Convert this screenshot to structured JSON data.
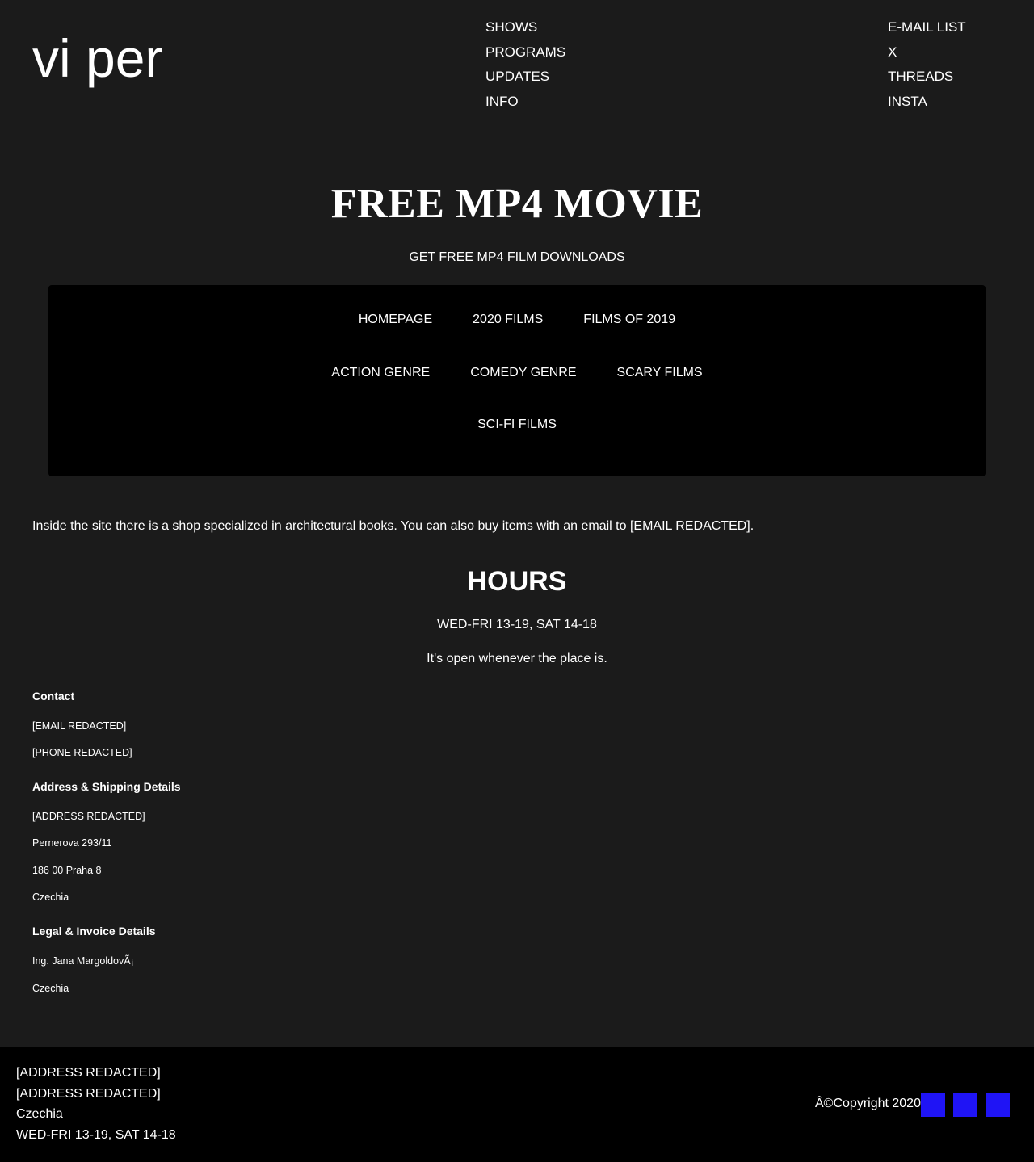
{
  "header": {
    "logo": "vi per",
    "nav_main": [
      "SHOWS",
      "PROGRAMS",
      "UPDATES",
      "INFO"
    ],
    "nav_social": [
      "E-MAIL LIST",
      "X",
      "THREADS",
      "INSTA"
    ]
  },
  "hero": {
    "title": "FREE MP4 MOVIE",
    "subtitle": "GET FREE MP4 FILM DOWNLOADS"
  },
  "menu": {
    "row1": [
      "HOMEPAGE",
      "2020 FILMS",
      "FILMS OF 2019"
    ],
    "row2": [
      "ACTION GENRE",
      "COMEDY GENRE",
      "SCARY FILMS"
    ],
    "row3": [
      "SCI-FI FILMS"
    ]
  },
  "intro": "Inside the site there is a shop specialized in architectural books. You can also buy items with an email to [EMAIL REDACTED].",
  "hours": {
    "title": "HOURS",
    "time": "WED-FRI 13-19, SAT 14-18",
    "note": "It's open whenever the place is."
  },
  "contact": {
    "heading": "Contact",
    "email": "[EMAIL REDACTED]",
    "phone": "[PHONE REDACTED]"
  },
  "address": {
    "heading": "Address & Shipping Details",
    "line1": "[ADDRESS REDACTED]",
    "line2": "Pernerova 293/11",
    "line3": "186 00 Praha 8",
    "line4": "Czechia"
  },
  "legal": {
    "heading": "Legal & Invoice Details",
    "line1": "Ing. Jana MargoldovÃ¡",
    "line2": "Czechia"
  },
  "footer": {
    "lines": [
      "[ADDRESS REDACTED]",
      "[ADDRESS REDACTED]",
      "Czechia",
      "WED-FRI 13-19, SAT 14-18"
    ],
    "copyright": "Â©Copyright 2020",
    "icon_color": "#1f14f5"
  }
}
